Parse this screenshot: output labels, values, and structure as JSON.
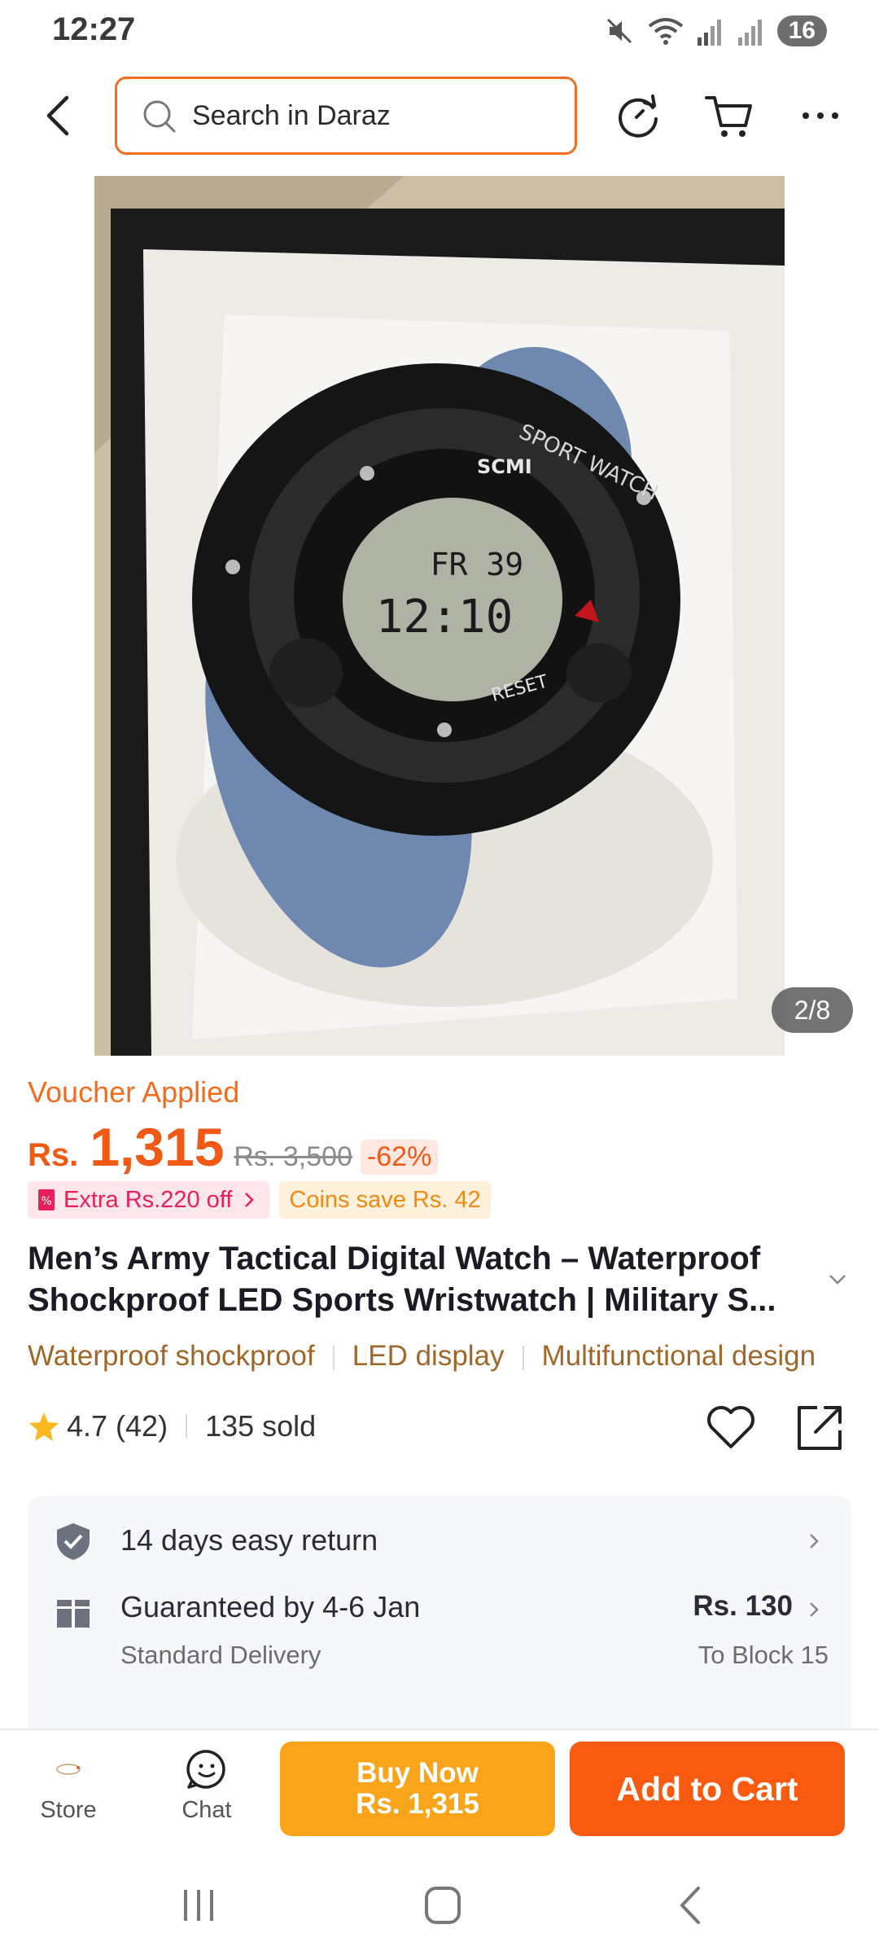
{
  "status_bar": {
    "time": "12:27",
    "badge": "16"
  },
  "header": {
    "search_placeholder": "Search in Daraz"
  },
  "gallery": {
    "counter": "2/8"
  },
  "pricing": {
    "voucher_label": "Voucher Applied",
    "currency": "Rs.",
    "price": "1,315",
    "original_price": "Rs. 3,500",
    "discount": "-62%",
    "extra_off": "Extra Rs.220 off",
    "coins": "Coins save Rs. 42"
  },
  "product": {
    "title": "Men’s Army Tactical Digital Watch – Waterproof Shockproof LED Sports Wristwatch | Military S...",
    "tags": [
      "Waterproof shockproof",
      "LED display",
      "Multifunctional design"
    ],
    "rating": "4.7",
    "reviews": "(42)",
    "sold": "135 sold"
  },
  "service": {
    "return_label": "14 days easy return",
    "delivery_label": "Guaranteed by 4-6 Jan",
    "delivery_type": "Standard Delivery",
    "delivery_price": "Rs. 130",
    "delivery_location": "To Block 15"
  },
  "bottom_bar": {
    "store": "Store",
    "chat": "Chat",
    "buy_now": "Buy Now",
    "buy_now_price": "Rs. 1,315",
    "add_to_cart": "Add to Cart"
  },
  "colors": {
    "accent": "#f36d1f",
    "buy_now": "#f9a51c",
    "add_to_cart": "#f85b0f"
  }
}
